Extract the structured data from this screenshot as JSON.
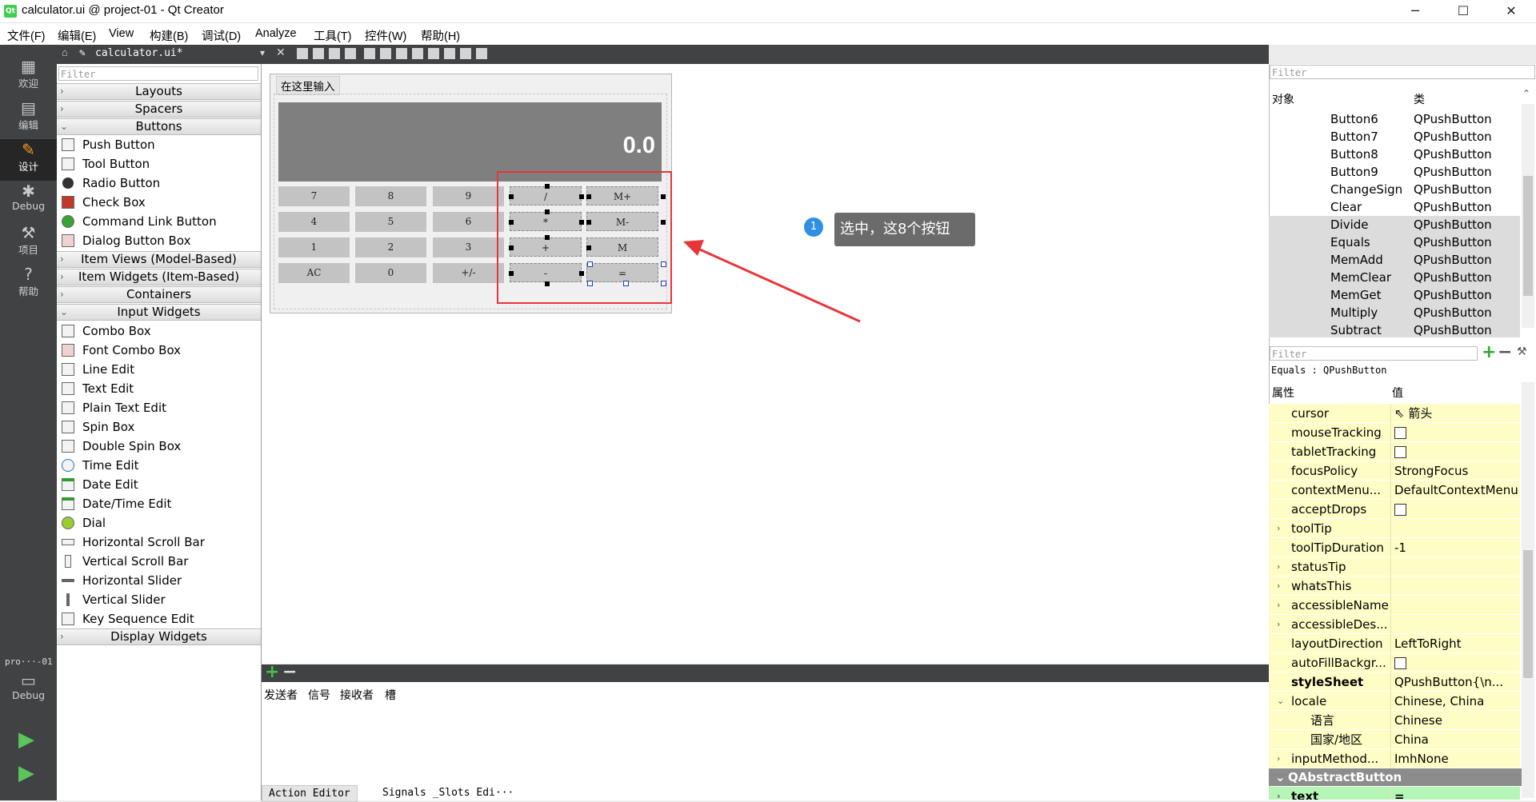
{
  "window": {
    "title": "calculator.ui @ project-01 - Qt Creator",
    "app_icon": "Qt",
    "minimize": "─",
    "maximize": "☐",
    "close": "✕"
  },
  "menu": [
    "文件(F)",
    "编辑(E)",
    "View",
    "构建(B)",
    "调试(D)",
    "Analyze",
    "工具(T)",
    "控件(W)",
    "帮助(H)"
  ],
  "modes": [
    {
      "label": "欢迎",
      "icon": "grid-icon"
    },
    {
      "label": "编辑",
      "icon": "document-icon"
    },
    {
      "label": "设计",
      "icon": "pencil-icon"
    },
    {
      "label": "Debug",
      "icon": "bug-icon"
    },
    {
      "label": "项目",
      "icon": "wrench-icon"
    },
    {
      "label": "帮助",
      "icon": "help-icon"
    }
  ],
  "kit": {
    "project": "pro···-01",
    "config": "Debug"
  },
  "editor_tab": "calculator.ui*",
  "widget_box": {
    "filter_placeholder": "Filter",
    "categories": [
      "Layouts",
      "Spacers",
      "Buttons",
      "Item Views (Model-Based)",
      "Item Widgets (Item-Based)",
      "Containers",
      "Input Widgets",
      "Display Widgets"
    ],
    "buttons": [
      "Push Button",
      "Tool Button",
      "Radio Button",
      "Check Box",
      "Command Link Button",
      "Dialog Button Box"
    ],
    "inputs": [
      "Combo Box",
      "Font Combo Box",
      "Line Edit",
      "Text Edit",
      "Plain Text Edit",
      "Spin Box",
      "Double Spin Box",
      "Time Edit",
      "Date Edit",
      "Date/Time Edit",
      "Dial",
      "Horizontal Scroll Bar",
      "Vertical Scroll Bar",
      "Horizontal Slider",
      "Vertical Slider",
      "Key Sequence Edit"
    ]
  },
  "form": {
    "hint": "在这里输入",
    "display_value": "0.0",
    "keys_row1": [
      "7",
      "8",
      "9",
      "/",
      "M+"
    ],
    "keys_row2": [
      "4",
      "5",
      "6",
      "*",
      "M-"
    ],
    "keys_row3": [
      "1",
      "2",
      "3",
      "+",
      "M"
    ],
    "keys_row4": [
      "AC",
      "0",
      "+/-",
      "-",
      "="
    ]
  },
  "callout": {
    "number": "1",
    "text": "选中，这8个按钮"
  },
  "signals": {
    "headers": [
      "发送者",
      "信号",
      "接收者",
      "槽"
    ],
    "add": "+",
    "remove": "−",
    "tabs": [
      "Action Editor",
      "Signals _Slots Edi···"
    ]
  },
  "object_inspector": {
    "filter_placeholder": "Filter",
    "col_object": "对象",
    "col_class": "类",
    "rows": [
      {
        "name": "Button6",
        "cls": "QPushButton"
      },
      {
        "name": "Button7",
        "cls": "QPushButton"
      },
      {
        "name": "Button8",
        "cls": "QPushButton"
      },
      {
        "name": "Button9",
        "cls": "QPushButton"
      },
      {
        "name": "ChangeSign",
        "cls": "QPushButton"
      },
      {
        "name": "Clear",
        "cls": "QPushButton"
      },
      {
        "name": "Divide",
        "cls": "QPushButton"
      },
      {
        "name": "Equals",
        "cls": "QPushButton"
      },
      {
        "name": "MemAdd",
        "cls": "QPushButton"
      },
      {
        "name": "MemClear",
        "cls": "QPushButton"
      },
      {
        "name": "MemGet",
        "cls": "QPushButton"
      },
      {
        "name": "Multiply",
        "cls": "QPushButton"
      },
      {
        "name": "Subtract",
        "cls": "QPushButton"
      }
    ]
  },
  "property_editor": {
    "filter_placeholder": "Filter",
    "current": "Equals : QPushButton",
    "col_prop": "属性",
    "col_value": "值",
    "rows": [
      {
        "name": "cursor",
        "value": "箭头"
      },
      {
        "name": "mouseTracking",
        "value": ""
      },
      {
        "name": "tabletTracking",
        "value": ""
      },
      {
        "name": "focusPolicy",
        "value": "StrongFocus"
      },
      {
        "name": "contextMenu...",
        "value": "DefaultContextMenu"
      },
      {
        "name": "acceptDrops",
        "value": ""
      },
      {
        "name": "toolTip",
        "value": ""
      },
      {
        "name": "toolTipDuration",
        "value": "-1"
      },
      {
        "name": "statusTip",
        "value": ""
      },
      {
        "name": "whatsThis",
        "value": ""
      },
      {
        "name": "accessibleName",
        "value": ""
      },
      {
        "name": "accessibleDes...",
        "value": ""
      },
      {
        "name": "layoutDirection",
        "value": "LeftToRight"
      },
      {
        "name": "autoFillBackgr...",
        "value": ""
      },
      {
        "name": "styleSheet",
        "value": "QPushButton{\\n..."
      },
      {
        "name": "locale",
        "value": "Chinese, China"
      },
      {
        "name": "语言",
        "value": "Chinese"
      },
      {
        "name": "国家/地区",
        "value": "China"
      },
      {
        "name": "inputMethod...",
        "value": "ImhNone"
      }
    ],
    "section": "QAbstractButton",
    "text_row": {
      "name": "text",
      "value": "="
    }
  }
}
